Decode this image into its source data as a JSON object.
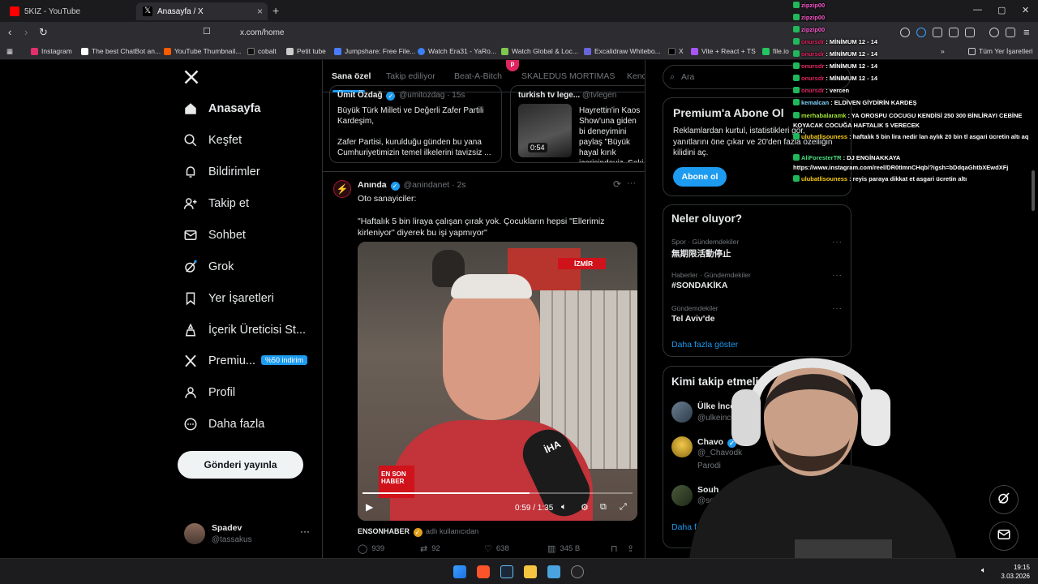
{
  "browser": {
    "tabs": [
      {
        "title": "5KIZ - YouTube",
        "active": false
      },
      {
        "title": "Anasayfa / X",
        "active": true
      }
    ],
    "url": "x.com/home",
    "bookmarks": [
      "Instagram",
      "The best ChatBot an...",
      "YouTube Thumbnail...",
      "cobalt",
      "Petit tube",
      "Jumpshare: Free File...",
      "Watch Era31 - YaRo...",
      "Watch Global & Loc...",
      "Excalidraw Whitebo...",
      "X",
      "Vite + React + TS",
      "file.io"
    ],
    "all_bookmarks": "Tüm Yer İşaretleri"
  },
  "nav": {
    "items": [
      "Anasayfa",
      "Keşfet",
      "Bildirimler",
      "Takip et",
      "Sohbet",
      "Grok",
      "Yer İşaretleri",
      "İçerik Üreticisi St...",
      "Premiu...",
      "Profil",
      "Daha fazla"
    ],
    "premium_badge": "%50 indirim",
    "post_button": "Gönderi yayınla",
    "user_name": "Spadev",
    "user_handle": "@tassakus"
  },
  "feed": {
    "tabs": [
      "Sana özel",
      "Takip ediliyor",
      "Beat-A-Bitch",
      "SKALEDUS MORTIMAS",
      "Kend"
    ],
    "quote1": {
      "head": "Ümit Özdağ",
      "handle": "@umitozdag · 15s",
      "text": "Büyük Türk Milleti ve Değerli Zafer Partili Kardeşim,\n\nZafer Partisi, kurulduğu günden bu yana Cumhuriyetimizin temel ilkelerini tavizsiz ..."
    },
    "quote2": {
      "head": "turkish tv lege...",
      "handle": "@tvlegen",
      "text": "Hayrettin'in Kaos Show'una giden bi deneyimini paylaş \"Büyük hayal kırık içerisindeyiz. Seki",
      "duration": "0:54"
    },
    "post": {
      "name": "Anında",
      "meta": "@anindanet · 2s",
      "text": "Oto sanayiciler:\n\n\"Haftalık 5 bin liraya çalışan çırak yok. Çocukların hepsi \"Ellerimiz kirleniyor\" diyerek bu işi yapmıyor\"",
      "video_time": "0:59 / 1:35",
      "video_progress": 0.62,
      "video_overlay": {
        "location": "İZMİR",
        "logo": "İHA",
        "corner": "EN SON HABER"
      },
      "source": "ENSONHABER",
      "source_sub": "adlı kullanıcıdan",
      "replies": "939",
      "reposts": "92",
      "likes": "638",
      "views": "345 B"
    }
  },
  "right": {
    "search_placeholder": "Ara",
    "premium_title": "Premium'a Abone Ol",
    "premium_desc": "Reklamlardan kurtul, istatistikleri gör, yanıtlarını öne çıkar ve 20'den fazla özelliğin kilidini aç.",
    "subscribe": "Abone ol",
    "trends_title": "Neler oluyor?",
    "trends": [
      {
        "cat": "Spor · Gündemdekiler",
        "name": "無期限活動停止"
      },
      {
        "cat": "Haberler · Gündemdekiler",
        "name": "#SONDAKİKA"
      },
      {
        "cat": "Gündemdekiler",
        "name": "Tel Aviv'de"
      }
    ],
    "show_more": "Daha fazla göster",
    "wtf_title": "Kimi takip etmeli",
    "wtf": [
      {
        "name": "Ülke İncelemesi",
        "handle": "@ulkeincelemesi"
      },
      {
        "name": "Chavo",
        "handle": "@_Chavodk",
        "extra": "Parodi"
      },
      {
        "name": "Souh",
        "handle": "@so"
      }
    ],
    "show_more2": "Daha fa"
  },
  "chat": [
    {
      "user": "zipzip00",
      "msg": ""
    },
    {
      "user": "zipzip00",
      "msg": ""
    },
    {
      "user": "zipzip00",
      "msg": ""
    },
    {
      "user": "onursdr",
      "msg": ": MİNİMUM 12 - 14"
    },
    {
      "user": "onursdr",
      "msg": ": MİNİMUM 12 - 14"
    },
    {
      "user": "onursdr",
      "msg": ": MİNİMUM 12 - 14"
    },
    {
      "user": "onursdr",
      "msg": ": MİNİMUM 12 - 14"
    },
    {
      "user": "onursdr",
      "msg": ": vercen"
    },
    {
      "user": "kemalcan",
      "msg": ": ELDİVEN GİYDİRİN KARDEŞ"
    },
    {
      "user": "merhabalaramk",
      "msg": ": YA OROSPU COCUGU KENDİSİ 250 300 BİNLİRAYI CEBİNE KOYACAK COCUĞA HAFTALIK 5 VERECEK"
    },
    {
      "user": "ulubatlisouness",
      "msg": ": haftalık 5 bin lira nedir lan aylık 20 bin tl asgari ücretin altı aq"
    },
    {
      "user": "AliForesterTR",
      "msg": ": DJ ENGİNAKKAYA https://www.instagram.com/reel/DR0tImnCHqb/?igsh=bDdqaGhtbXEwdXFj"
    },
    {
      "user": "ulubatlisouness",
      "msg": ": reyis paraya dikkat et asgari ücretin altı"
    }
  ],
  "taskbar": {
    "time": "19:15",
    "date": "3.03.2026"
  },
  "colors": {
    "accent": "#1d9bf0",
    "bg": "#000000",
    "border": "#2f3336",
    "muted": "#71767b"
  }
}
